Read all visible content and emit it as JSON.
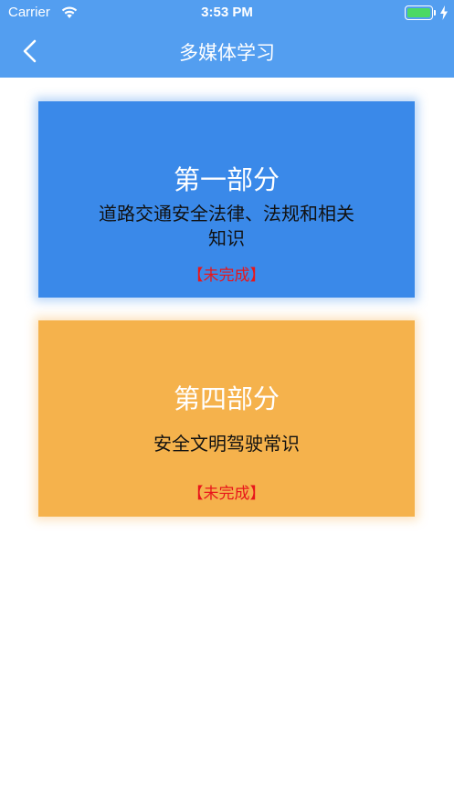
{
  "status_bar": {
    "carrier": "Carrier",
    "time": "3:53 PM",
    "battery_level": 1.0
  },
  "nav": {
    "title": "多媒体学习",
    "back_icon": "chevron-left-icon"
  },
  "cards": [
    {
      "title": "第一部分",
      "subtitle": "道路交通安全法律、法规和相关知识",
      "status": "【未完成】",
      "color": "#3a89e9"
    },
    {
      "title": "第四部分",
      "subtitle": "安全文明驾驶常识",
      "status": "【未完成】",
      "color": "#f5b24c"
    }
  ],
  "colors": {
    "header": "#539ef0",
    "status_text": "#e8161b",
    "battery": "#4cd964"
  }
}
